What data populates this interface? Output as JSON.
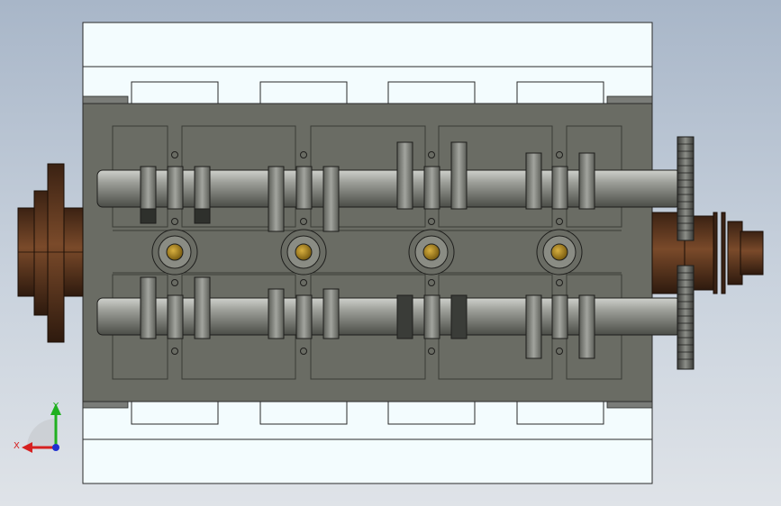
{
  "viewport": {
    "background_top": "#a8b6c8",
    "background_bottom": "#dfe3e8"
  },
  "model": {
    "view": "top",
    "colors": {
      "plate": "#f3fcfe",
      "block": "#6a6c64",
      "block_edge": "#3c3e38",
      "shaft": "#8a8c86",
      "bearing": "#b08a1c",
      "pulley": "#5a3520",
      "gear": "#4a4b47"
    }
  },
  "triad": {
    "x_label": "X",
    "y_label": "Y",
    "x_color": "#d62020",
    "y_color": "#20b020",
    "origin_color": "#2030d0"
  }
}
